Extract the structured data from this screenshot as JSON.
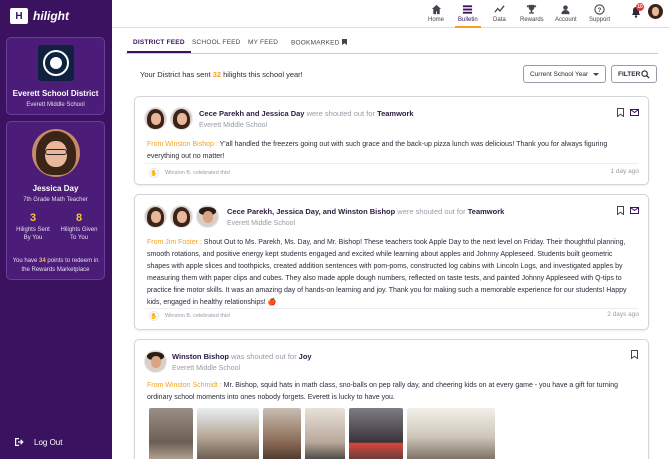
{
  "app": {
    "logo_letter": "H",
    "name": "hilight"
  },
  "sidebar": {
    "district_name": "Everett School District",
    "district_school": "Everett Middle School",
    "user": {
      "name": "Jessica Day",
      "role": "7th Grade Math Teacher",
      "sent_count": "3",
      "sent_label_1": "Hilights Sent",
      "sent_label_2": "By You",
      "given_count": "8",
      "given_label_1": "Hilights Given",
      "given_label_2": "To You",
      "points_prefix": "You have",
      "points_value": "34",
      "points_suffix": "points to redeem in the Rewards Marketplace"
    },
    "logout_label": "Log Out"
  },
  "topnav": {
    "items": [
      {
        "label": "Home",
        "icon": "home-icon"
      },
      {
        "label": "Bulletin",
        "icon": "bulletin-icon"
      },
      {
        "label": "Data",
        "icon": "chart-line-icon"
      },
      {
        "label": "Rewards",
        "icon": "trophy-icon"
      },
      {
        "label": "Account",
        "icon": "user-icon"
      },
      {
        "label": "Support",
        "icon": "help-icon"
      }
    ],
    "notification_count": "10"
  },
  "tabs": [
    {
      "label": "DISTRICT FEED"
    },
    {
      "label": "SCHOOL FEED"
    },
    {
      "label": "MY FEED"
    },
    {
      "label": "BOOKMARKED"
    }
  ],
  "summary": {
    "prefix": "Your District has sent",
    "count": "32",
    "suffix": "hilights this school year!"
  },
  "year_select": {
    "value": "Current School Year"
  },
  "filter_label": "FILTER",
  "posts": [
    {
      "who": "Cece Parekh and Jessica Day",
      "verb": "were shouted out for",
      "tag": "Teamwork",
      "school": "Everett Middle School",
      "from": "From Winston Bishop :",
      "body": "Y'all handled the freezers going out with such grace and the back-up pizza lunch was delicious! Thank you for always figuring everything out no matter!",
      "celebrated": "Winston B. celebrated this!",
      "ago": "1 day ago"
    },
    {
      "who": "Cece Parekh, Jessica Day, and Winston Bishop",
      "verb": "were shouted out for",
      "tag": "Teamwork",
      "school": "Everett Middle School",
      "from": "From Jim Foster :",
      "body": "Shout Out to Ms. Parekh, Ms. Day, and Mr. Bishop! These teachers took Apple Day to the next level on Friday. Their thoughtful planning, smooth rotations, and positive energy kept students engaged and excited while learning about apples and Johnny Appleseed. Students built geometric shapes with apple slices and toothpicks, created addition sentences with pom-poms, constructed log cabins with Lincoln Logs, and investigated apples by measuring them with paper clips and cubes. They also made apple dough numbers, reflected on taste tests, and painted Johnny Appleseed with Q-tips to practice fine motor skills. It was an amazing day of hands-on learning and joy. Thank you for making such a memorable experience for our students! Happy kids, engaged in healthy relationships! 🍎",
      "celebrated": "Winston B. celebrated this!",
      "ago": "2 days ago"
    },
    {
      "who": "Winston Bishop",
      "verb": "was shouted out for",
      "tag": "Joy",
      "school": "Everett Middle School",
      "from": "From Winston Schmidt :",
      "body": "Mr. Bishop, squid hats in math class, sno-balls on pep rally day, and cheering kids on at every game - you have a gift for turning ordinary school moments into ones nobody forgets. Everett is lucky to have you."
    }
  ],
  "colors": {
    "sidebar": "#3a1260",
    "accent": "#f6a21e",
    "gold": "#f6c344"
  }
}
